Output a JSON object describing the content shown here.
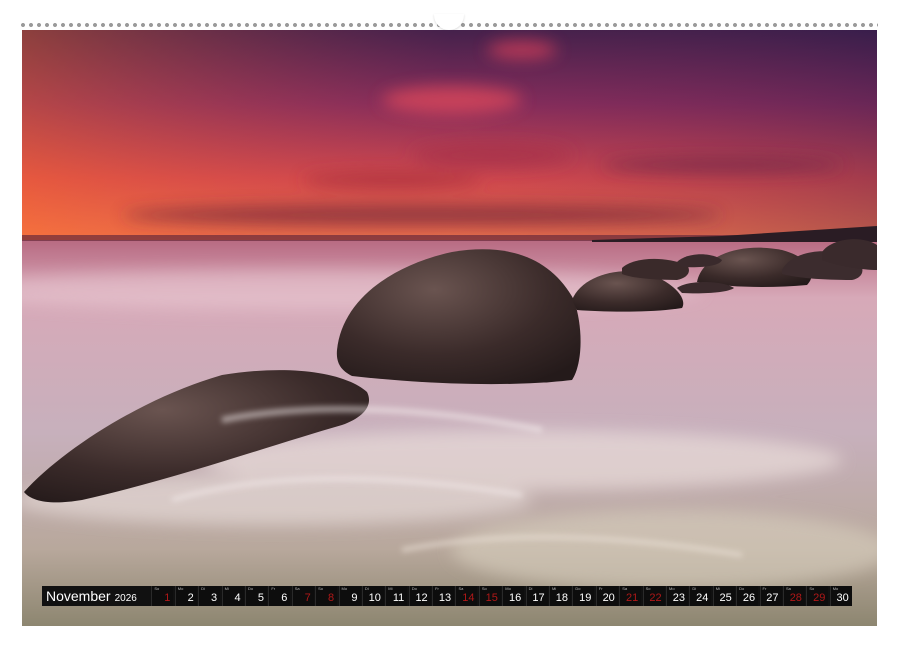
{
  "calendar": {
    "month": "November",
    "year": "2026",
    "days": [
      {
        "n": "1",
        "wd": "So",
        "weekend": true
      },
      {
        "n": "2",
        "wd": "Mo",
        "weekend": false
      },
      {
        "n": "3",
        "wd": "Di",
        "weekend": false
      },
      {
        "n": "4",
        "wd": "Mi",
        "weekend": false
      },
      {
        "n": "5",
        "wd": "Do",
        "weekend": false
      },
      {
        "n": "6",
        "wd": "Fr",
        "weekend": false
      },
      {
        "n": "7",
        "wd": "Sa",
        "weekend": true
      },
      {
        "n": "8",
        "wd": "So",
        "weekend": true
      },
      {
        "n": "9",
        "wd": "Mo",
        "weekend": false
      },
      {
        "n": "10",
        "wd": "Di",
        "weekend": false
      },
      {
        "n": "11",
        "wd": "Mi",
        "weekend": false
      },
      {
        "n": "12",
        "wd": "Do",
        "weekend": false
      },
      {
        "n": "13",
        "wd": "Fr",
        "weekend": false
      },
      {
        "n": "14",
        "wd": "Sa",
        "weekend": true
      },
      {
        "n": "15",
        "wd": "So",
        "weekend": true
      },
      {
        "n": "16",
        "wd": "Mo",
        "weekend": false
      },
      {
        "n": "17",
        "wd": "Di",
        "weekend": false
      },
      {
        "n": "18",
        "wd": "Mi",
        "weekend": false
      },
      {
        "n": "19",
        "wd": "Do",
        "weekend": false
      },
      {
        "n": "20",
        "wd": "Fr",
        "weekend": false
      },
      {
        "n": "21",
        "wd": "Sa",
        "weekend": true
      },
      {
        "n": "22",
        "wd": "So",
        "weekend": true
      },
      {
        "n": "23",
        "wd": "Mo",
        "weekend": false
      },
      {
        "n": "24",
        "wd": "Di",
        "weekend": false
      },
      {
        "n": "25",
        "wd": "Mi",
        "weekend": false
      },
      {
        "n": "26",
        "wd": "Do",
        "weekend": false
      },
      {
        "n": "27",
        "wd": "Fr",
        "weekend": false
      },
      {
        "n": "28",
        "wd": "Sa",
        "weekend": true
      },
      {
        "n": "29",
        "wd": "So",
        "weekend": true
      },
      {
        "n": "30",
        "wd": "Mo",
        "weekend": false
      }
    ]
  },
  "photo": {
    "subject": "seascape-sunset-rocks-icon",
    "colors": {
      "sky_top": "#3a1f4a",
      "sky_mid": "#a8345a",
      "horizon": "#f07040",
      "water": "#c9b2bc",
      "rock": "#3a2a28"
    }
  }
}
